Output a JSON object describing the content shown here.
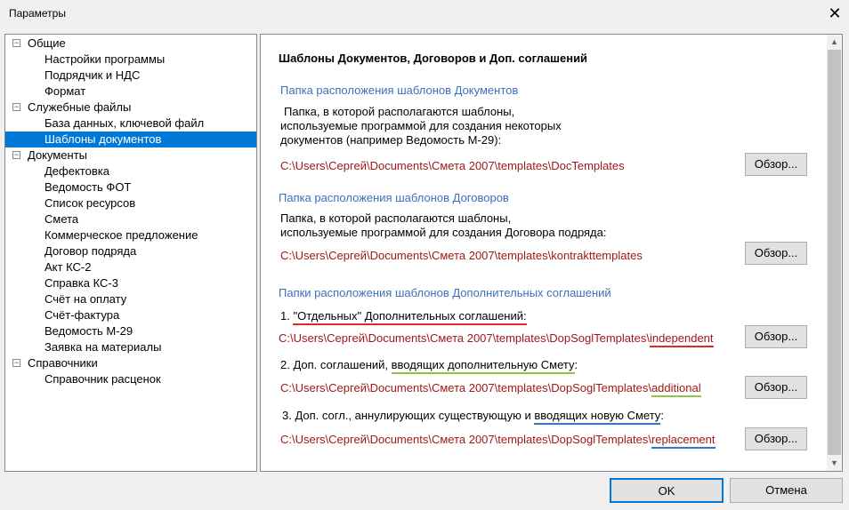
{
  "window": {
    "title": "Параметры",
    "close": "✕"
  },
  "tree": [
    {
      "label": "Общие",
      "level": 0
    },
    {
      "label": "Настройки программы",
      "level": 1
    },
    {
      "label": "Подрядчик и НДС",
      "level": 1
    },
    {
      "label": "Формат",
      "level": 1
    },
    {
      "label": "Служебные файлы",
      "level": 0
    },
    {
      "label": "База данных, ключевой файл",
      "level": 1
    },
    {
      "label": "Шаблоны документов",
      "level": 1,
      "selected": true
    },
    {
      "label": "Документы",
      "level": 0
    },
    {
      "label": "Дефектовка",
      "level": 1
    },
    {
      "label": "Ведомость ФОТ",
      "level": 1
    },
    {
      "label": "Список ресурсов",
      "level": 1
    },
    {
      "label": "Смета",
      "level": 1
    },
    {
      "label": "Коммерческое предложение",
      "level": 1
    },
    {
      "label": "Договор подряда",
      "level": 1
    },
    {
      "label": "Акт КС-2",
      "level": 1
    },
    {
      "label": "Справка КС-3",
      "level": 1
    },
    {
      "label": "Счёт на оплату",
      "level": 1
    },
    {
      "label": "Счёт-фактура",
      "level": 1
    },
    {
      "label": "Ведомость М-29",
      "level": 1
    },
    {
      "label": "Заявка на материалы",
      "level": 1
    },
    {
      "label": "Справочники",
      "level": 0
    },
    {
      "label": "Справочник расценок",
      "level": 1
    }
  ],
  "main": {
    "heading": "Шаблоны Документов, Договоров и Доп. соглашений",
    "docs": {
      "title": "Папка расположения шаблонов Документов",
      "desc1": "Папка, в которой располагаются шаблоны,",
      "desc2": "используемые программой для создания некоторых",
      "desc3": "документов (например Ведомость М-29):",
      "path": "C:\\Users\\Сергей\\Documents\\Смета 2007\\templates\\DocTemplates"
    },
    "contracts": {
      "title": "Папка расположения шаблонов Договоров",
      "desc1": "Папка,  в которой располагаются  шаблоны,",
      "desc2": "используемые программой для создания Договора подряда:",
      "path": "C:\\Users\\Сергей\\Documents\\Смета 2007\\templates\\kontrakttemplates"
    },
    "agreements": {
      "title": "Папки расположения  шаблонов  Дополнительных  соглашений",
      "i1_pre": "1.  ",
      "i1_u": "\"Отдельных\" Дополнительных соглашений:",
      "i1_path": "C:\\Users\\Сергей\\Documents\\Смета  2007\\templates\\DopSoglTemplates\\",
      "i1_sub": "independent",
      "i2_pre": "2.  Доп. соглашений, ",
      "i2_u": "вводящих дополнительную Смету",
      "i2_post": ":",
      "i2_path": "C:\\Users\\Сергей\\Documents\\Смета  2007\\templates\\DopSoglTemplates\\",
      "i2_sub": "additional",
      "i3_pre": "3.  Доп. согл., аннулирующих существующую и ",
      "i3_u": "вводящих новую Смету",
      "i3_post": ":",
      "i3_path": "C:\\Users\\Сергей\\Documents\\Смета  2007\\templates\\DopSoglTemplates\\",
      "i3_sub": "replacement"
    },
    "browse": "Обзор..."
  },
  "footer": {
    "ok": "OK",
    "cancel": "Отмена"
  }
}
